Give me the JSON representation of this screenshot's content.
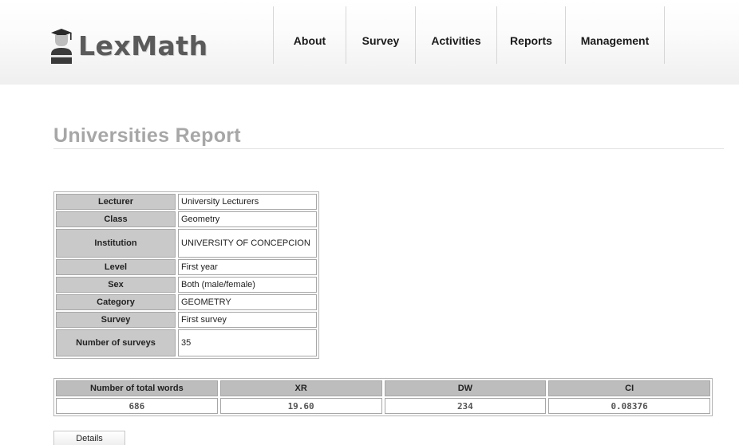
{
  "header": {
    "logo": {
      "part1": "Lex",
      "part2": "Math",
      "icon": "graduate-icon"
    },
    "nav": [
      {
        "label": "About"
      },
      {
        "label": "Survey"
      },
      {
        "label": "Activities"
      },
      {
        "label": "Reports"
      },
      {
        "label": "Management"
      }
    ]
  },
  "page": {
    "title": "Universities Report"
  },
  "details": {
    "rows": [
      {
        "label": "Lecturer",
        "value": "University Lecturers"
      },
      {
        "label": "Class",
        "value": "Geometry"
      },
      {
        "label": "Institution",
        "value": "UNIVERSITY OF CONCEPCION"
      },
      {
        "label": "Level",
        "value": "First year"
      },
      {
        "label": "Sex",
        "value": "Both (male/female)"
      },
      {
        "label": "Category",
        "value": "GEOMETRY"
      },
      {
        "label": "Survey",
        "value": "First survey"
      },
      {
        "label": "Number of surveys",
        "value": "35"
      }
    ]
  },
  "summary": {
    "headers": [
      "Number of total words",
      "XR",
      "DW",
      "CI"
    ],
    "values": [
      "686",
      "19.60",
      "234",
      "0.08376"
    ]
  },
  "actions": {
    "details_label": "Details"
  },
  "colors": {
    "label_bg": "#c9c9c9",
    "header_bg": "#bdbdbd",
    "title": "#a7a7a7"
  }
}
